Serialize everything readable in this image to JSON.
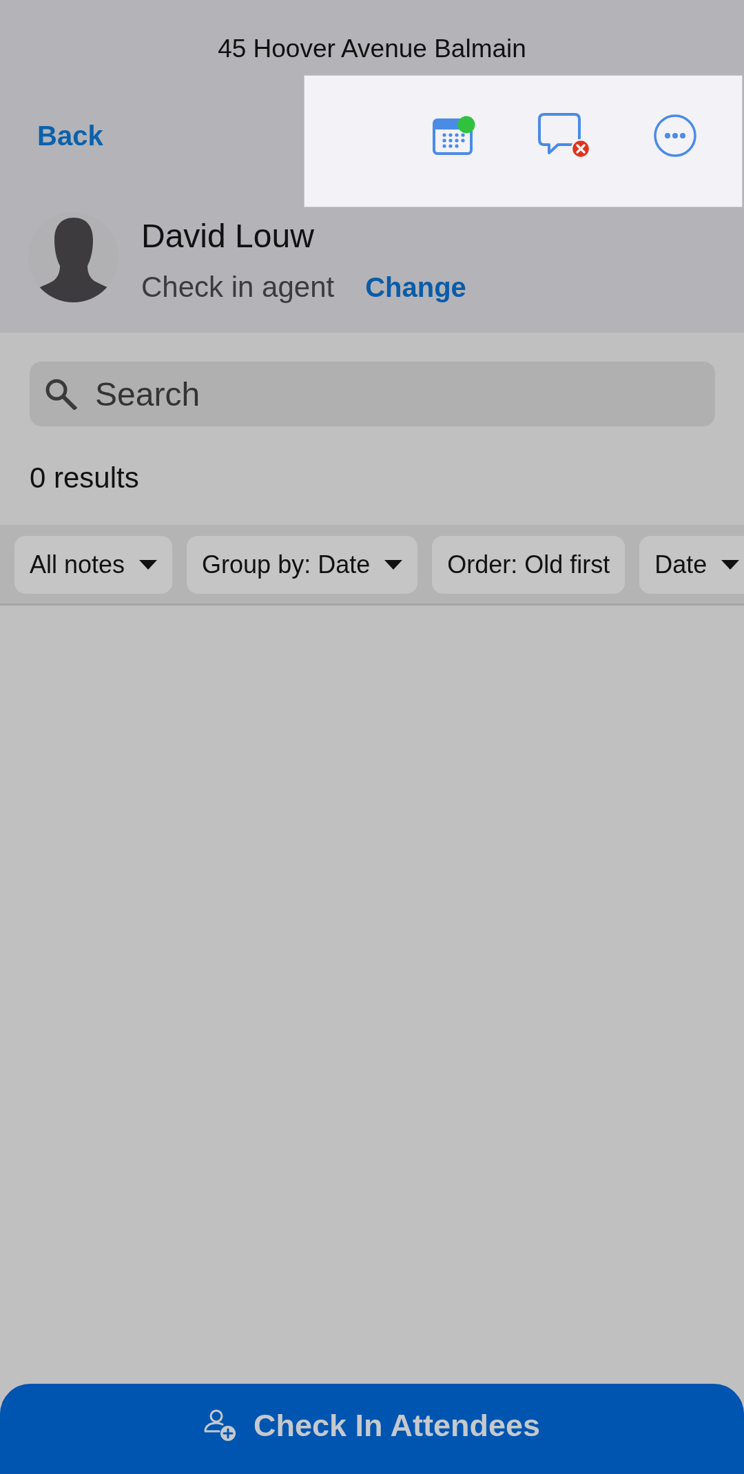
{
  "header": {
    "title": "45 Hoover Avenue Balmain",
    "back_button": "Back"
  },
  "agent": {
    "name": "David Louw",
    "role": "Check in agent",
    "change_link": "Change"
  },
  "search": {
    "placeholder": "Search"
  },
  "results_count": "0 results",
  "filters": [
    {
      "label": "All notes",
      "dropdown": true
    },
    {
      "label": "Group by: Date",
      "dropdown": true
    },
    {
      "label": "Order: Old first",
      "dropdown": false
    },
    {
      "label": "Date",
      "dropdown": true
    }
  ],
  "primary_button": {
    "label": "Check In Attendees"
  }
}
